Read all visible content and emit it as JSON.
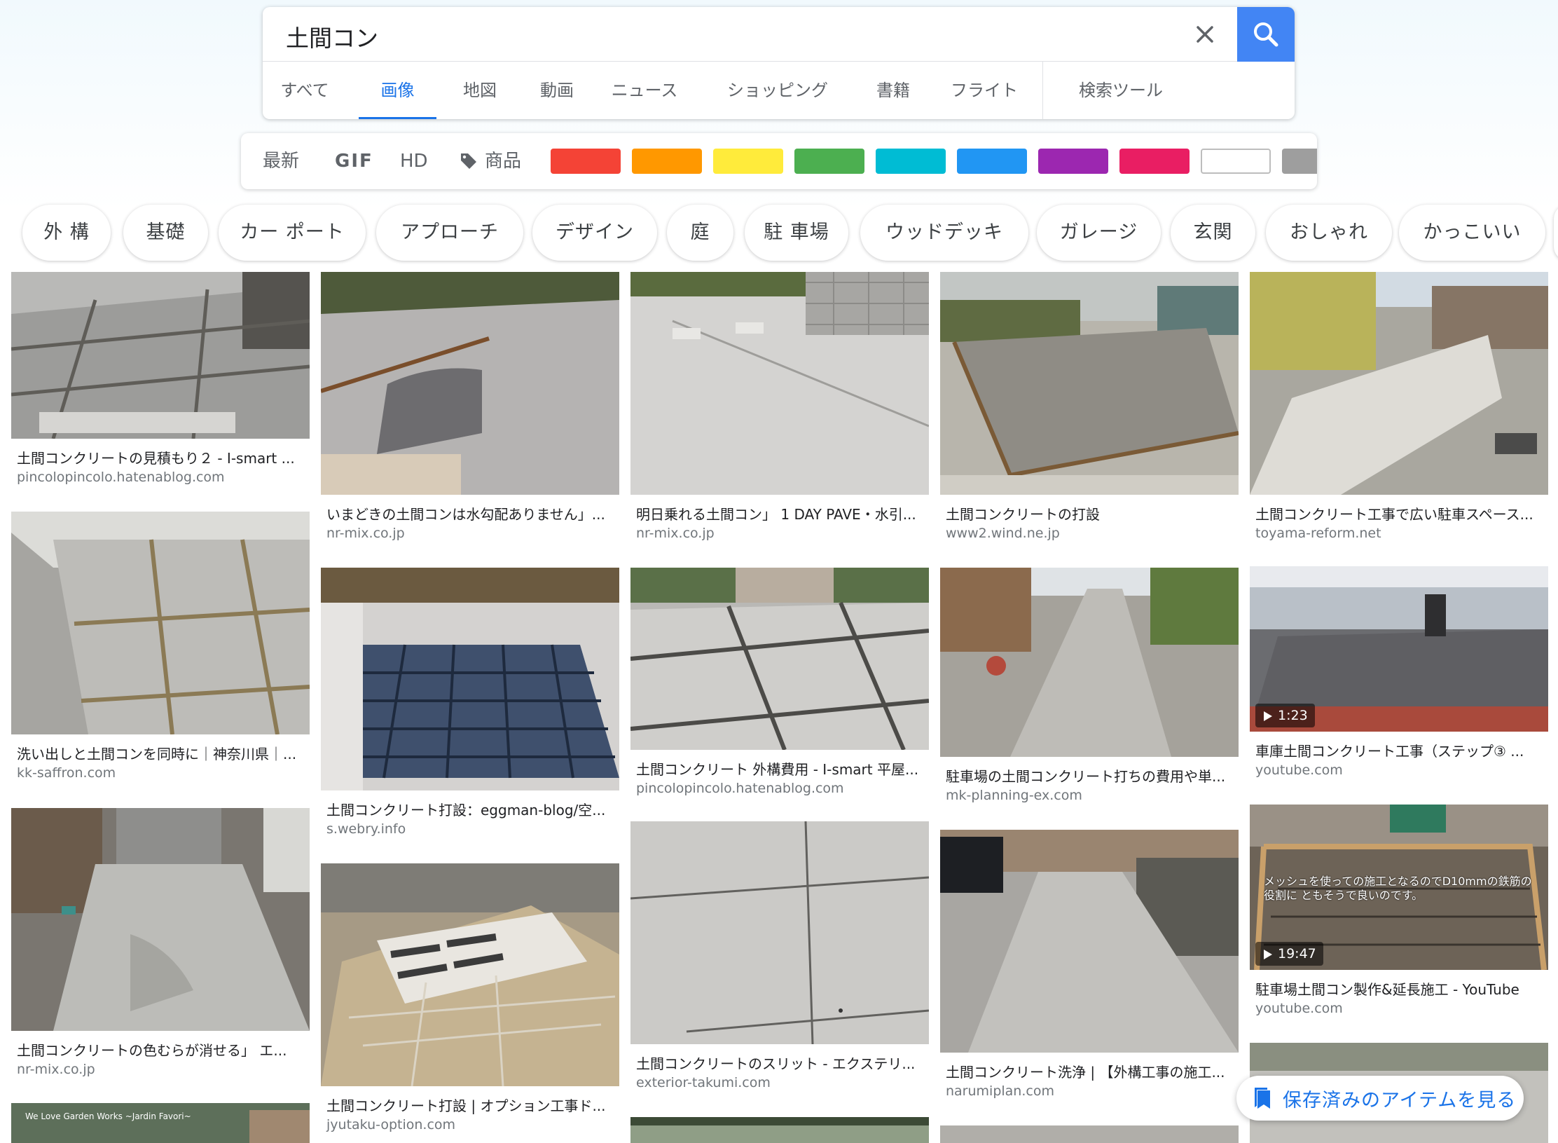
{
  "search": {
    "query": "土間コン",
    "tabs": [
      "すべて",
      "画像",
      "地図",
      "動画",
      "ニュース",
      "ショッピング",
      "書籍",
      "フライト",
      "検索ツール"
    ],
    "active_tab": "画像"
  },
  "filters": {
    "items": [
      "最新",
      "GIF",
      "HD",
      "商品"
    ],
    "colors": [
      "#f44336",
      "#ff9800",
      "#ffeb3b",
      "#4caf50",
      "#00bcd4",
      "#2196f3",
      "#9c27b0",
      "#e91e63",
      "#ffffff",
      "#9e9e9e"
    ]
  },
  "chips": [
    "外 構",
    "基礎",
    "カー ポート",
    "アプローチ",
    "デザイン",
    "庭",
    "駐 車場",
    "ウッドデッキ",
    "ガレージ",
    "玄関",
    "おしゃれ",
    "かっこいい"
  ],
  "results": {
    "col1": [
      {
        "caption": "土間コンクリートの見積もり２ - I-smart ...",
        "domain": "pincolopincolo.hatenablog.com"
      },
      {
        "caption": "洗い出しと土間コンを同時に｜神奈川県｜...",
        "domain": "kk-saffron.com"
      },
      {
        "caption": "土間コンクリートの色むらが消せる」 エ...",
        "domain": "nr-mix.co.jp"
      },
      {
        "caption": "We Love Garden Works ~Jardin Favori~",
        "domain": ""
      }
    ],
    "col2": [
      {
        "caption": "いまどきの土間コンは水勾配ありません」...",
        "domain": "nr-mix.co.jp"
      },
      {
        "caption": "土間コンクリート打設：eggman-blog/空...",
        "domain": "s.webry.info"
      },
      {
        "caption": "土間コンクリート打設 | オプション工事ド...",
        "domain": "jyutaku-option.com"
      }
    ],
    "col3": [
      {
        "caption": "明日乗れる土間コン」 1 DAY PAVE・水引...",
        "domain": "nr-mix.co.jp"
      },
      {
        "caption": "土間コンクリート 外構費用 - I-smart 平屋...",
        "domain": "pincolopincolo.hatenablog.com"
      },
      {
        "caption": "土間コンクリートのスリット - エクステリ...",
        "domain": "exterior-takumi.com"
      }
    ],
    "col4": [
      {
        "caption": "土間コンクリートの打設",
        "domain": "www2.wind.ne.jp"
      },
      {
        "caption": "駐車場の土間コンクリート打ちの費用や単...",
        "domain": "mk-planning-ex.com"
      },
      {
        "caption": "土間コンクリート洗浄 | 【外構工事の施工...",
        "domain": "narumiplan.com"
      }
    ],
    "col5": [
      {
        "caption": "土間コンクリート工事で広い駐車スペース...",
        "domain": "toyama-reform.net"
      },
      {
        "caption": "車庫土間コンクリート工事（ステップ③ ...",
        "domain": "youtube.com",
        "duration": "1:23"
      },
      {
        "caption": "駐車場土間コン製作&延長施工 - YouTube",
        "domain": "youtube.com",
        "duration": "19:47",
        "overlay": "メッシュを使っての施工となるのでD10mmの鉄筋の役割に ともそうで良いのです。"
      }
    ]
  },
  "saved_items": {
    "label": "保存済みのアイテムを見る"
  }
}
